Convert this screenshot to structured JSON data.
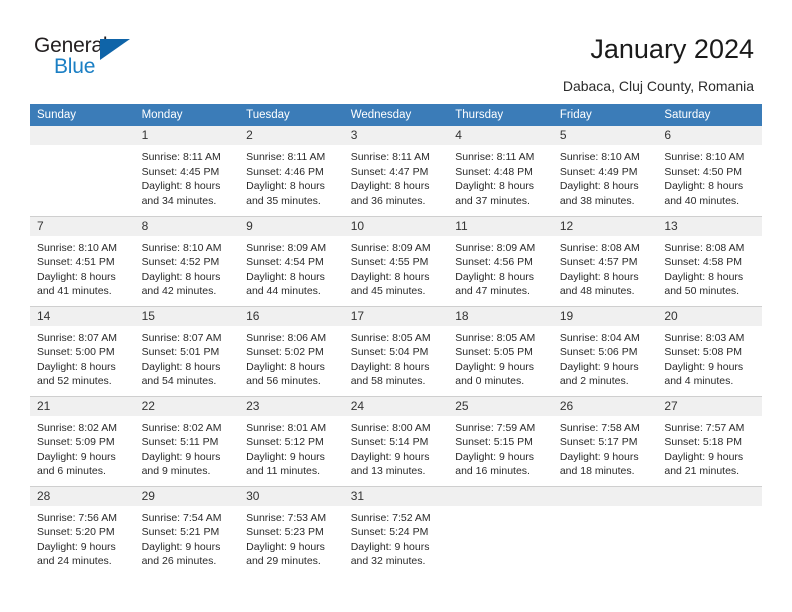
{
  "brand": {
    "name_top": "General",
    "name_bottom": "Blue",
    "accent_color": "#0f64a8",
    "blue_text_color": "#1b7fc4"
  },
  "header": {
    "title": "January 2024",
    "subtitle": "Dabaca, Cluj County, Romania"
  },
  "calendar": {
    "header_bg": "#3b7cb8",
    "daynum_bg": "#f0f0f0",
    "columns": [
      "Sunday",
      "Monday",
      "Tuesday",
      "Wednesday",
      "Thursday",
      "Friday",
      "Saturday"
    ],
    "weeks": [
      [
        {
          "day": "",
          "lines": []
        },
        {
          "day": "1",
          "lines": [
            "Sunrise: 8:11 AM",
            "Sunset: 4:45 PM",
            "Daylight: 8 hours",
            "and 34 minutes."
          ]
        },
        {
          "day": "2",
          "lines": [
            "Sunrise: 8:11 AM",
            "Sunset: 4:46 PM",
            "Daylight: 8 hours",
            "and 35 minutes."
          ]
        },
        {
          "day": "3",
          "lines": [
            "Sunrise: 8:11 AM",
            "Sunset: 4:47 PM",
            "Daylight: 8 hours",
            "and 36 minutes."
          ]
        },
        {
          "day": "4",
          "lines": [
            "Sunrise: 8:11 AM",
            "Sunset: 4:48 PM",
            "Daylight: 8 hours",
            "and 37 minutes."
          ]
        },
        {
          "day": "5",
          "lines": [
            "Sunrise: 8:10 AM",
            "Sunset: 4:49 PM",
            "Daylight: 8 hours",
            "and 38 minutes."
          ]
        },
        {
          "day": "6",
          "lines": [
            "Sunrise: 8:10 AM",
            "Sunset: 4:50 PM",
            "Daylight: 8 hours",
            "and 40 minutes."
          ]
        }
      ],
      [
        {
          "day": "7",
          "lines": [
            "Sunrise: 8:10 AM",
            "Sunset: 4:51 PM",
            "Daylight: 8 hours",
            "and 41 minutes."
          ]
        },
        {
          "day": "8",
          "lines": [
            "Sunrise: 8:10 AM",
            "Sunset: 4:52 PM",
            "Daylight: 8 hours",
            "and 42 minutes."
          ]
        },
        {
          "day": "9",
          "lines": [
            "Sunrise: 8:09 AM",
            "Sunset: 4:54 PM",
            "Daylight: 8 hours",
            "and 44 minutes."
          ]
        },
        {
          "day": "10",
          "lines": [
            "Sunrise: 8:09 AM",
            "Sunset: 4:55 PM",
            "Daylight: 8 hours",
            "and 45 minutes."
          ]
        },
        {
          "day": "11",
          "lines": [
            "Sunrise: 8:09 AM",
            "Sunset: 4:56 PM",
            "Daylight: 8 hours",
            "and 47 minutes."
          ]
        },
        {
          "day": "12",
          "lines": [
            "Sunrise: 8:08 AM",
            "Sunset: 4:57 PM",
            "Daylight: 8 hours",
            "and 48 minutes."
          ]
        },
        {
          "day": "13",
          "lines": [
            "Sunrise: 8:08 AM",
            "Sunset: 4:58 PM",
            "Daylight: 8 hours",
            "and 50 minutes."
          ]
        }
      ],
      [
        {
          "day": "14",
          "lines": [
            "Sunrise: 8:07 AM",
            "Sunset: 5:00 PM",
            "Daylight: 8 hours",
            "and 52 minutes."
          ]
        },
        {
          "day": "15",
          "lines": [
            "Sunrise: 8:07 AM",
            "Sunset: 5:01 PM",
            "Daylight: 8 hours",
            "and 54 minutes."
          ]
        },
        {
          "day": "16",
          "lines": [
            "Sunrise: 8:06 AM",
            "Sunset: 5:02 PM",
            "Daylight: 8 hours",
            "and 56 minutes."
          ]
        },
        {
          "day": "17",
          "lines": [
            "Sunrise: 8:05 AM",
            "Sunset: 5:04 PM",
            "Daylight: 8 hours",
            "and 58 minutes."
          ]
        },
        {
          "day": "18",
          "lines": [
            "Sunrise: 8:05 AM",
            "Sunset: 5:05 PM",
            "Daylight: 9 hours",
            "and 0 minutes."
          ]
        },
        {
          "day": "19",
          "lines": [
            "Sunrise: 8:04 AM",
            "Sunset: 5:06 PM",
            "Daylight: 9 hours",
            "and 2 minutes."
          ]
        },
        {
          "day": "20",
          "lines": [
            "Sunrise: 8:03 AM",
            "Sunset: 5:08 PM",
            "Daylight: 9 hours",
            "and 4 minutes."
          ]
        }
      ],
      [
        {
          "day": "21",
          "lines": [
            "Sunrise: 8:02 AM",
            "Sunset: 5:09 PM",
            "Daylight: 9 hours",
            "and 6 minutes."
          ]
        },
        {
          "day": "22",
          "lines": [
            "Sunrise: 8:02 AM",
            "Sunset: 5:11 PM",
            "Daylight: 9 hours",
            "and 9 minutes."
          ]
        },
        {
          "day": "23",
          "lines": [
            "Sunrise: 8:01 AM",
            "Sunset: 5:12 PM",
            "Daylight: 9 hours",
            "and 11 minutes."
          ]
        },
        {
          "day": "24",
          "lines": [
            "Sunrise: 8:00 AM",
            "Sunset: 5:14 PM",
            "Daylight: 9 hours",
            "and 13 minutes."
          ]
        },
        {
          "day": "25",
          "lines": [
            "Sunrise: 7:59 AM",
            "Sunset: 5:15 PM",
            "Daylight: 9 hours",
            "and 16 minutes."
          ]
        },
        {
          "day": "26",
          "lines": [
            "Sunrise: 7:58 AM",
            "Sunset: 5:17 PM",
            "Daylight: 9 hours",
            "and 18 minutes."
          ]
        },
        {
          "day": "27",
          "lines": [
            "Sunrise: 7:57 AM",
            "Sunset: 5:18 PM",
            "Daylight: 9 hours",
            "and 21 minutes."
          ]
        }
      ],
      [
        {
          "day": "28",
          "lines": [
            "Sunrise: 7:56 AM",
            "Sunset: 5:20 PM",
            "Daylight: 9 hours",
            "and 24 minutes."
          ]
        },
        {
          "day": "29",
          "lines": [
            "Sunrise: 7:54 AM",
            "Sunset: 5:21 PM",
            "Daylight: 9 hours",
            "and 26 minutes."
          ]
        },
        {
          "day": "30",
          "lines": [
            "Sunrise: 7:53 AM",
            "Sunset: 5:23 PM",
            "Daylight: 9 hours",
            "and 29 minutes."
          ]
        },
        {
          "day": "31",
          "lines": [
            "Sunrise: 7:52 AM",
            "Sunset: 5:24 PM",
            "Daylight: 9 hours",
            "and 32 minutes."
          ]
        },
        {
          "day": "",
          "lines": []
        },
        {
          "day": "",
          "lines": []
        },
        {
          "day": "",
          "lines": []
        }
      ]
    ]
  }
}
